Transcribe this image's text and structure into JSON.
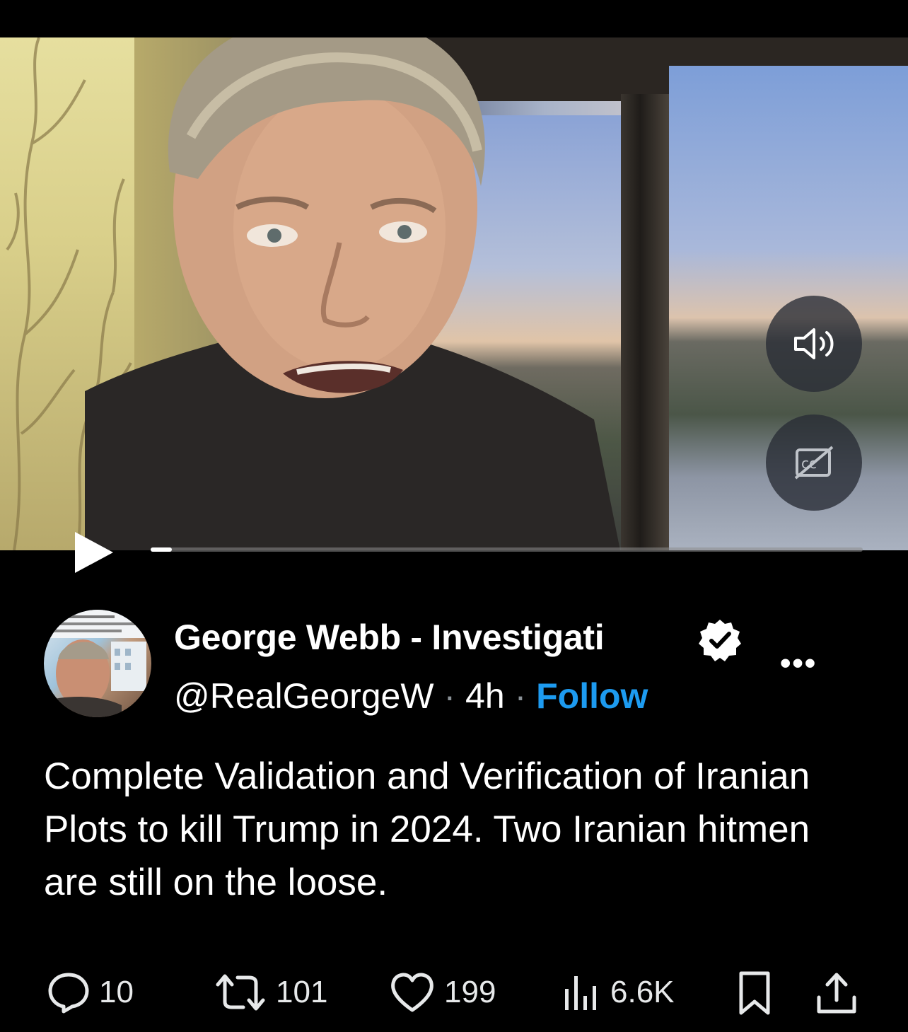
{
  "video": {
    "sound_icon": "speaker-icon",
    "captions_icon": "captions-off-icon",
    "play_icon": "play-icon",
    "progress_fraction": 0.03
  },
  "author": {
    "display_name": "George Webb - Investigati",
    "handle": "@RealGeorgeW",
    "separator": "·",
    "time": "4h",
    "follow_label": "Follow",
    "verified_icon": "verified-badge-icon",
    "more_icon": "more-icon",
    "more_label": "•••"
  },
  "post": {
    "text": "Complete Validation and Verification of Iranian Plots to kill Trump in 2024.  Two Iranian hitmen are still on the loose."
  },
  "actions": {
    "replies": "10",
    "reposts": "101",
    "likes": "199",
    "views": "6.6K"
  },
  "colors": {
    "accent": "#1d9bf0",
    "background": "#000000",
    "text": "#ffffff",
    "muted": "#8b9298"
  }
}
